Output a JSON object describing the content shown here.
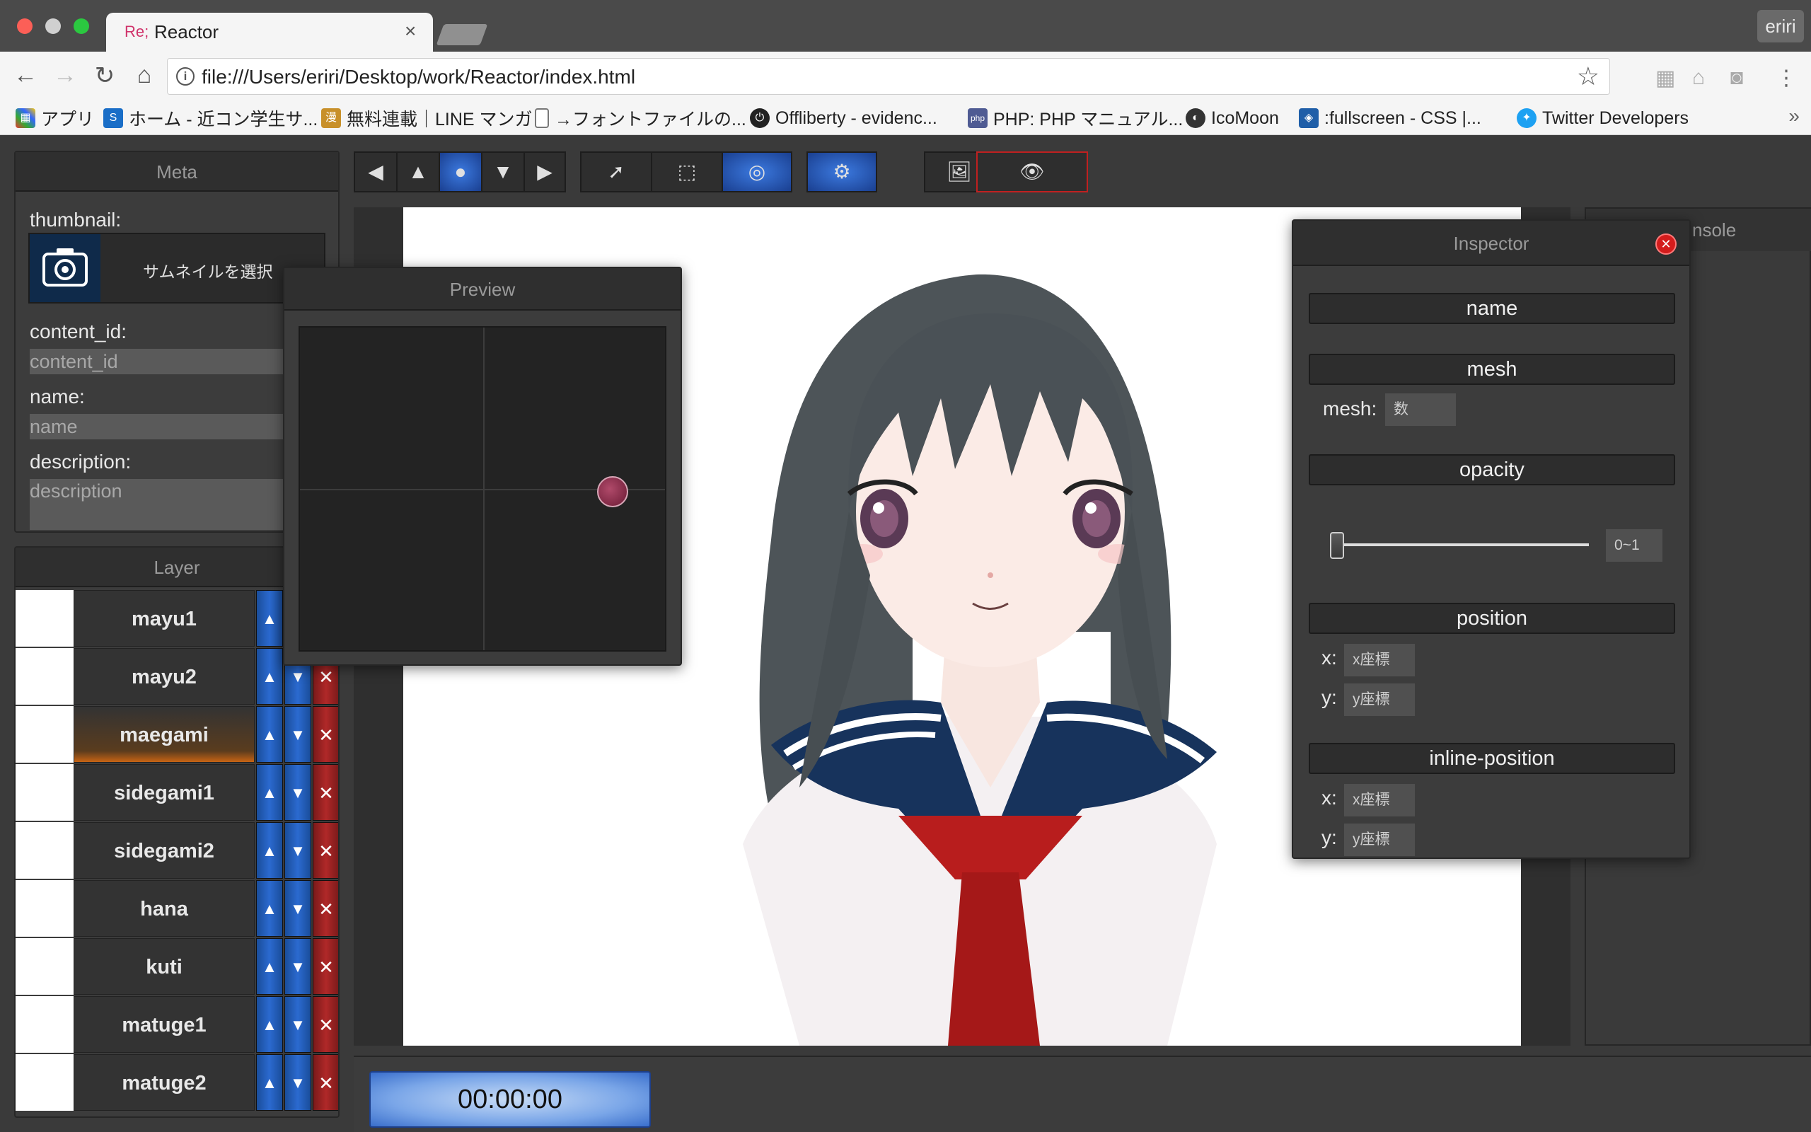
{
  "browser": {
    "tab_favicon": "Re;",
    "tab_title": "Reactor",
    "tab_close": "×",
    "user_name": "eriri",
    "url": "file:///Users/eriri/Desktop/work/Reactor/index.html",
    "bookmarks": [
      "アプリ",
      "ホーム - 近コン学生サ...",
      "無料連載｜LINE マンガ",
      "→フォントファイルの...",
      "Offliberty - evidenc...",
      "PHP: PHP マニュアル...",
      "IcoMoon",
      ":fullscreen - CSS |...",
      "Twitter Developers"
    ],
    "bookmarks_more": "»"
  },
  "meta": {
    "title": "Meta",
    "thumbnail_label": "thumbnail:",
    "thumbnail_button": "サムネイルを選択",
    "content_id_label": "content_id:",
    "content_id_placeholder": "content_id",
    "name_label": "name:",
    "name_placeholder": "name",
    "description_label": "description:",
    "description_placeholder": "description"
  },
  "layer": {
    "title": "Layer",
    "items": [
      {
        "name": "mayu1",
        "selected": false
      },
      {
        "name": "mayu2",
        "selected": false
      },
      {
        "name": "maegami",
        "selected": true
      },
      {
        "name": "sidegami1",
        "selected": false
      },
      {
        "name": "sidegami2",
        "selected": false
      },
      {
        "name": "hana",
        "selected": false
      },
      {
        "name": "kuti",
        "selected": false
      },
      {
        "name": "matuge1",
        "selected": false
      },
      {
        "name": "matuge2",
        "selected": false
      }
    ],
    "delete_glyph": "✕"
  },
  "preview": {
    "title": "Preview"
  },
  "inspector": {
    "title": "Inspector",
    "name_section": "name",
    "mesh_section": "mesh",
    "mesh_label": "mesh:",
    "mesh_placeholder": "数",
    "opacity_section": "opacity",
    "opacity_placeholder": "0~1",
    "opacity_value": 0,
    "position_section": "position",
    "x_label": "x:",
    "y_label": "y:",
    "x_placeholder": "x座標",
    "y_placeholder": "y座標",
    "inline_position_section": "inline-position"
  },
  "console": {
    "title": "nsole"
  },
  "timeline": {
    "time": "00:00:00"
  },
  "colors": {
    "accent_blue": "#2b6ad0",
    "danger_red": "#b02828",
    "selected_orange": "#c86414"
  }
}
